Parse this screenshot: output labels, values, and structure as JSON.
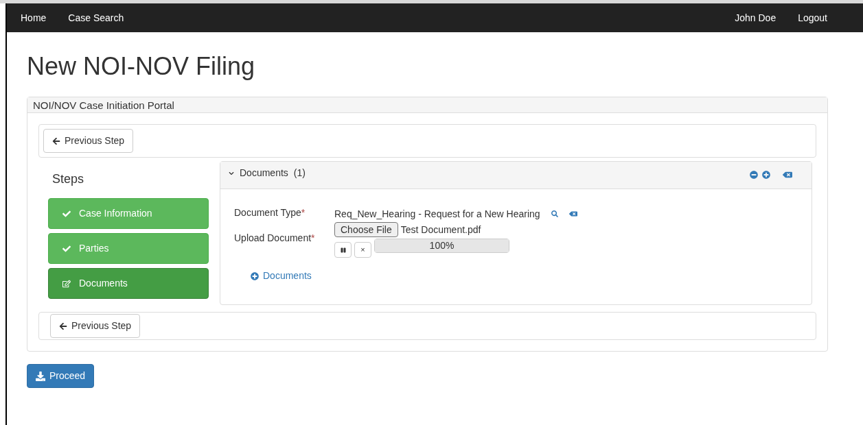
{
  "navbar": {
    "left": [
      "Home",
      "Case Search"
    ],
    "right": [
      "John Doe",
      "Logout"
    ]
  },
  "page_title": "New NOI-NOV Filing",
  "portal": {
    "title": "NOI/NOV Case Initiation Portal",
    "top_button": "Previous Step",
    "steps_heading": "Steps",
    "steps": [
      {
        "label": "Case Information",
        "kind": "done",
        "selected": false
      },
      {
        "label": "Parties",
        "kind": "done",
        "selected": false
      },
      {
        "label": "Documents",
        "kind": "current",
        "selected": true
      }
    ],
    "documents_panel": {
      "title": "Documents",
      "count": "(1)",
      "expanded": true,
      "document_type_label": "Document Type",
      "document_type_value": "Req_New_Hearing - Request for a New Hearing",
      "upload_label": "Upload Document",
      "choose_file": "Choose File",
      "file_name": "Test Document.pdf",
      "cancel_glyph": "×",
      "progress": {
        "level": 1.0,
        "reading": "100%"
      },
      "required_mark": "*",
      "add_link": "Documents"
    },
    "bottom_button": "Previous Step"
  },
  "proceed_button": "Proceed"
}
